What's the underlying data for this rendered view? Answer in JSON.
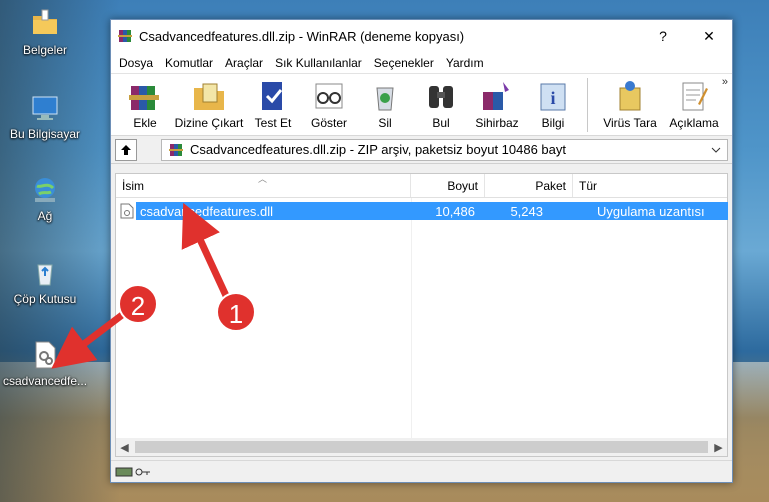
{
  "desktop": {
    "icons": [
      {
        "label": "Belgeler"
      },
      {
        "label": "Bu Bilgisayar"
      },
      {
        "label": "Ağ"
      },
      {
        "label": "Çöp Kutusu"
      },
      {
        "label": "csadvancedfe..."
      }
    ]
  },
  "window": {
    "title": "Csadvancedfeatures.dll.zip - WinRAR (deneme kopyası)",
    "help_label": "?",
    "close_label": "✕",
    "menu": [
      "Dosya",
      "Komutlar",
      "Araçlar",
      "Sık Kullanılanlar",
      "Seçenekler",
      "Yardım"
    ],
    "toolbar": [
      {
        "label": "Ekle",
        "icon": "books-add-icon"
      },
      {
        "label": "Dizine Çıkart",
        "icon": "folder-extract-icon"
      },
      {
        "label": "Test Et",
        "icon": "book-check-icon"
      },
      {
        "label": "Göster",
        "icon": "glasses-view-icon"
      },
      {
        "label": "Sil",
        "icon": "recycle-delete-icon"
      },
      {
        "label": "Bul",
        "icon": "binoculars-find-icon"
      },
      {
        "label": "Sihirbaz",
        "icon": "wizard-icon"
      },
      {
        "label": "Bilgi",
        "icon": "info-icon"
      },
      {
        "label": "Virüs Tara",
        "icon": "virus-scan-icon"
      },
      {
        "label": "Açıklama",
        "icon": "comment-icon"
      }
    ],
    "toolbar_more": "»",
    "address": "Csadvancedfeatures.dll.zip - ZIP arşiv, paketsiz boyut 10486 bayt",
    "columns": {
      "name": "İsim",
      "size": "Boyut",
      "packed": "Paket",
      "type": "Tür"
    },
    "files": [
      {
        "name": "csadvancedfeatures.dll",
        "size": "10,486",
        "packed": "5,243",
        "type": "Uygulama uzantısı"
      }
    ]
  },
  "callouts": {
    "one": "1",
    "two": "2"
  },
  "colors": {
    "selection": "#3399ff",
    "callout": "#e0312d",
    "accent": "#6d8fb7"
  }
}
